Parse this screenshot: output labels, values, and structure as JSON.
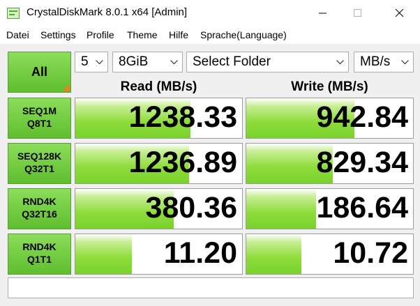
{
  "window": {
    "title": "CrystalDiskMark 8.0.1 x64 [Admin]"
  },
  "menu": [
    "Datei",
    "Settings",
    "Profile",
    "Theme",
    "Hilfe",
    "Sprache(Language)"
  ],
  "controls": {
    "all_label": "All",
    "count": "5",
    "size": "8GiB",
    "folder": "Select Folder",
    "unit": "MB/s"
  },
  "headers": {
    "read": "Read (MB/s)",
    "write": "Write (MB/s)"
  },
  "tests": [
    {
      "line1": "SEQ1M",
      "line2": "Q8T1",
      "read": "1238.33",
      "write": "942.84",
      "read_fill": 0.69,
      "write_fill": 0.65
    },
    {
      "line1": "SEQ128K",
      "line2": "Q32T1",
      "read": "1236.89",
      "write": "829.34",
      "read_fill": 0.68,
      "write_fill": 0.52
    },
    {
      "line1": "RND4K",
      "line2": "Q32T16",
      "read": "380.36",
      "write": "186.64",
      "read_fill": 0.59,
      "write_fill": 0.42
    },
    {
      "line1": "RND4K",
      "line2": "Q1T1",
      "read": "11.20",
      "write": "10.72",
      "read_fill": 0.34,
      "write_fill": 0.33
    }
  ],
  "status_text": "",
  "colors": {
    "button_green": "#6fc93c",
    "bar_green": "#8ddc3a",
    "corner_orange": "#e8811f"
  }
}
